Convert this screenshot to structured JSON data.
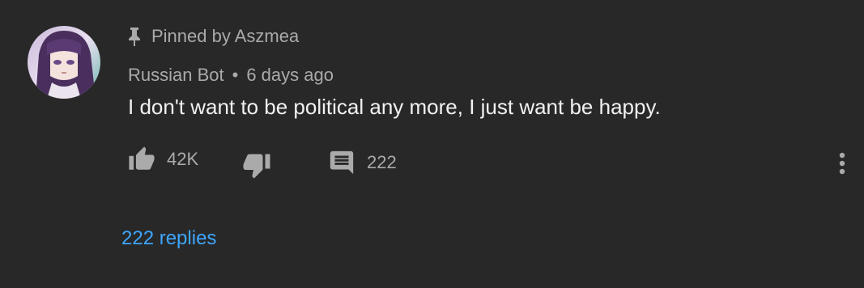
{
  "comment": {
    "pinned_label": "Pinned by Aszmea",
    "author": "Russian Bot",
    "separator": "•",
    "time_ago": "6 days ago",
    "text": "I don't want to be political any more, I just want be happy.",
    "like_count": "42K",
    "reply_count": "222",
    "replies_link": "222 replies"
  },
  "icons": {
    "pin": "pin-icon",
    "like": "thumbs-up-icon",
    "dislike": "thumbs-down-icon",
    "reply": "comment-icon",
    "more": "more-vertical-icon"
  },
  "colors": {
    "background": "#282828",
    "text_primary": "#f1f1f1",
    "text_secondary": "#aaaaaa",
    "link": "#3ea6ff"
  }
}
